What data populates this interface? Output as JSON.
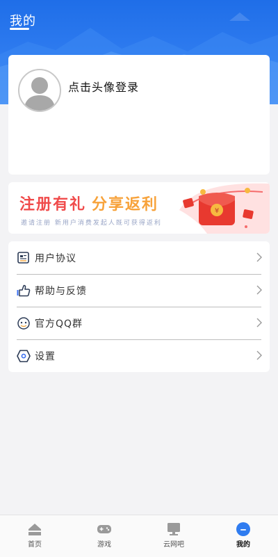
{
  "header": {
    "title": "我的"
  },
  "profile": {
    "login_prompt": "点击头像登录"
  },
  "promo": {
    "title_part1": "注册有礼",
    "title_part2": "分享返利",
    "subtitle": "邀请注册 新用户消费发起人既可获得返利",
    "coin_symbol": "¥"
  },
  "menu": {
    "items": [
      {
        "label": "用户协议",
        "icon": "document-icon"
      },
      {
        "label": "帮助与反馈",
        "icon": "thumbs-up-icon"
      },
      {
        "label": "官方QQ群",
        "icon": "qq-icon"
      },
      {
        "label": "设置",
        "icon": "settings-hexagon-icon"
      }
    ]
  },
  "tabbar": {
    "items": [
      {
        "label": "首页",
        "icon": "home-icon"
      },
      {
        "label": "游戏",
        "icon": "gamepad-icon"
      },
      {
        "label": "云网吧",
        "icon": "monitor-icon"
      },
      {
        "label": "我的",
        "icon": "profile-icon"
      }
    ],
    "active": "我的"
  },
  "colors": {
    "header_blue": "#2f7cf0",
    "promo_red": "#f04b4b",
    "promo_orange": "#f7a23a",
    "tab_active": "#2f7cf0",
    "tab_inactive": "#9a9a9a"
  }
}
